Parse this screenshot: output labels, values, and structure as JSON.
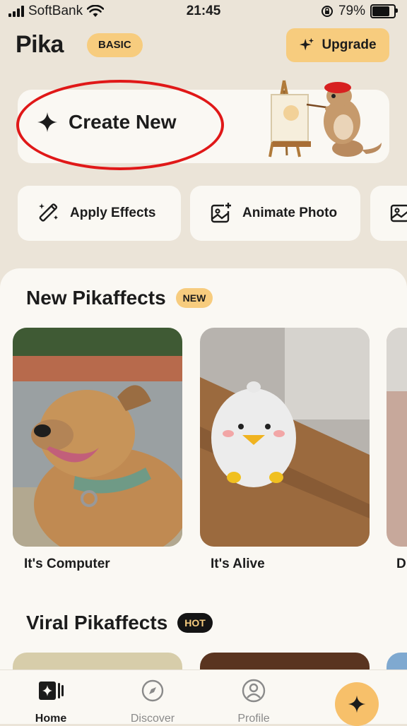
{
  "status_bar": {
    "carrier": "SoftBank",
    "time": "21:45",
    "battery": "79%",
    "battery_level": 0.79
  },
  "header": {
    "logo": "Pika",
    "plan_badge": "BASIC",
    "upgrade_label": "Upgrade"
  },
  "create_card": {
    "label": "Create New"
  },
  "quick_actions": [
    {
      "label": "Apply Effects",
      "icon": "magic-wand-icon"
    },
    {
      "label": "Animate Photo",
      "icon": "add-photo-icon"
    },
    {
      "label": "",
      "icon": "image-icon"
    }
  ],
  "sections": {
    "new": {
      "title": "New Pikaffects",
      "tag": "NEW",
      "items": [
        {
          "label": "It's Computer"
        },
        {
          "label": "It's Alive"
        },
        {
          "label": "D"
        }
      ]
    },
    "viral": {
      "title": "Viral Pikaffects",
      "tag": "HOT"
    }
  },
  "nav": {
    "home": "Home",
    "discover": "Discover",
    "profile": "Profile"
  },
  "colors": {
    "accent": "#f7cc7e",
    "background": "#ebe4d8",
    "card": "#faf8f3",
    "annotation": "#e01818"
  }
}
